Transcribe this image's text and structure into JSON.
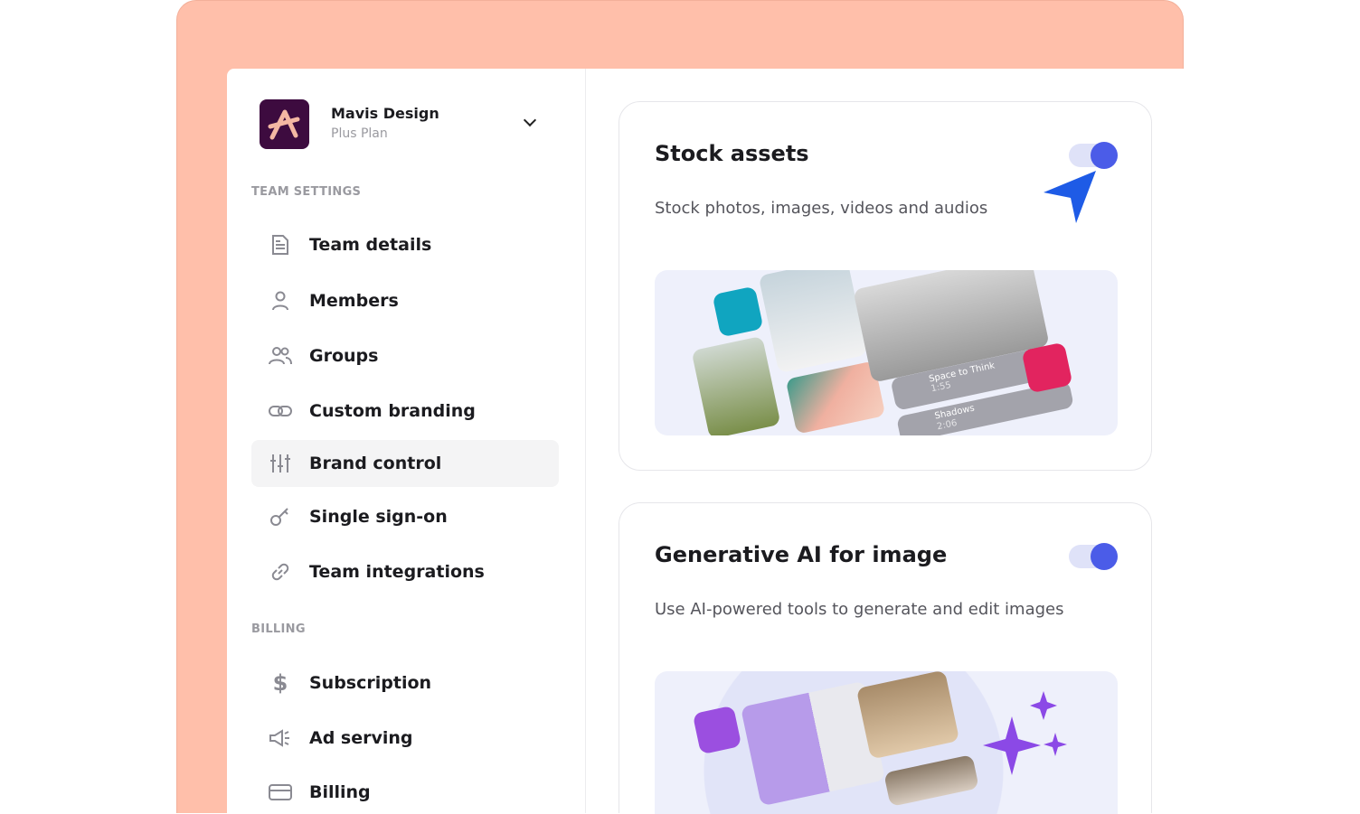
{
  "org": {
    "name": "Mavis Design",
    "plan": "Plus Plan"
  },
  "sections": {
    "team": "TEAM SETTINGS",
    "billing": "BILLING"
  },
  "team_items": [
    {
      "label": "Team details",
      "icon": "document-icon"
    },
    {
      "label": "Members",
      "icon": "person-icon"
    },
    {
      "label": "Groups",
      "icon": "people-icon"
    },
    {
      "label": "Custom branding",
      "icon": "link-icon"
    },
    {
      "label": "Brand control",
      "icon": "sliders-icon",
      "selected": true
    },
    {
      "label": "Single sign-on",
      "icon": "key-icon"
    },
    {
      "label": "Team integrations",
      "icon": "chain-icon"
    }
  ],
  "billing_items": [
    {
      "label": "Subscription",
      "icon": "dollar-icon"
    },
    {
      "label": "Ad serving",
      "icon": "megaphone-icon"
    },
    {
      "label": "Billing",
      "icon": "card-icon"
    }
  ],
  "cards": [
    {
      "title": "Stock assets",
      "desc": "Stock photos, images, videos and audios",
      "enabled": true,
      "tracks": [
        {
          "name": "Space to Think",
          "time": "1:55"
        },
        {
          "name": "Shadows",
          "time": "2:06"
        }
      ]
    },
    {
      "title": "Generative AI for image",
      "desc": "Use AI-powered tools to generate and edit images",
      "enabled": true
    }
  ],
  "colors": {
    "frame": "#ffbfaa",
    "accent": "#4b5ce8",
    "logo_bg": "#3d0b3f",
    "logo_fg": "#f4b7a3"
  }
}
